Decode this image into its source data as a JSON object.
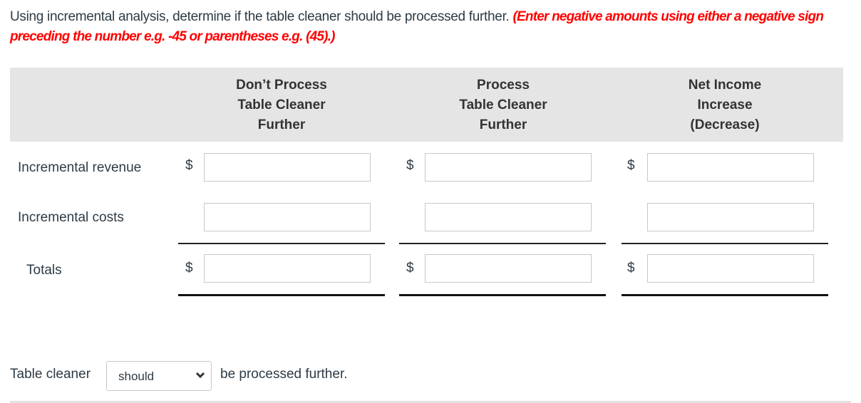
{
  "question": {
    "text": "Using incremental analysis, determine if the table cleaner should be processed further.",
    "instruction": "(Enter negative amounts using either a negative sign preceding the number e.g. -45 or parentheses e.g. (45).)"
  },
  "columns": [
    {
      "line1": "Don’t Process",
      "line2": "Table Cleaner",
      "line3": "Further"
    },
    {
      "line1": "Process",
      "line2": "Table Cleaner",
      "line3": "Further"
    },
    {
      "line1": "Net Income",
      "line2": "Increase",
      "line3": "(Decrease)"
    }
  ],
  "rows": [
    {
      "label": "Incremental revenue",
      "currency": "$",
      "values": [
        "",
        "",
        ""
      ]
    },
    {
      "label": "Incremental costs",
      "currency": "",
      "values": [
        "",
        "",
        ""
      ]
    },
    {
      "label": "Totals",
      "currency": "$",
      "values": [
        "",
        "",
        ""
      ]
    }
  ],
  "conclusion": {
    "prefix": "Table cleaner",
    "selected": "should",
    "suffix": "be processed further."
  }
}
